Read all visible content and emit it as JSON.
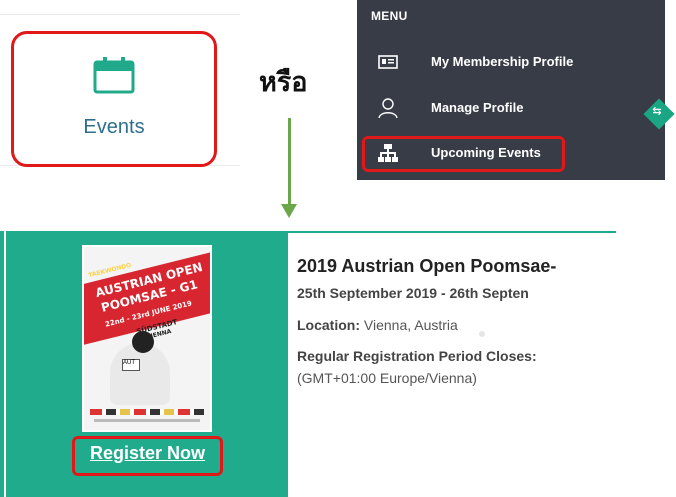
{
  "events_tile": {
    "label": "Events",
    "icon": "calendar-icon",
    "accent": "#2e6f8e",
    "icon_color": "#20a98a"
  },
  "or_text": "หรือ",
  "menu": {
    "title": "MENU",
    "items": [
      {
        "label": "My Membership Profile",
        "icon": "id-card-icon"
      },
      {
        "label": "Manage Profile",
        "icon": "user-icon"
      },
      {
        "label": "Upcoming Events",
        "icon": "sitemap-icon"
      }
    ],
    "background": "#383c46",
    "toggle_icon": "collapse-arrows-icon"
  },
  "highlight_color": "#e01818",
  "arrow_color": "#6aa74a",
  "event": {
    "title": "2019 Austrian Open Poomsae-",
    "dates": "25th September 2019 - 26th Septen",
    "location_label": "Location:",
    "location_value": "Vienna, Austria",
    "registration_label": "Regular Registration Period Closes:",
    "timezone": "(GMT+01:00 Europe/Vienna)",
    "register_label": "Register Now",
    "poster": {
      "line1": "TAEKWONDO",
      "line2": "AUSTRIAN OPEN",
      "line3": "POOMSAE - G1",
      "line4": "22nd - 23rd JUNE 2019",
      "line5": "SÜDSTADT",
      "line6": "VIENNA",
      "badge": "AUT"
    },
    "panel_color": "#21ab8d"
  }
}
